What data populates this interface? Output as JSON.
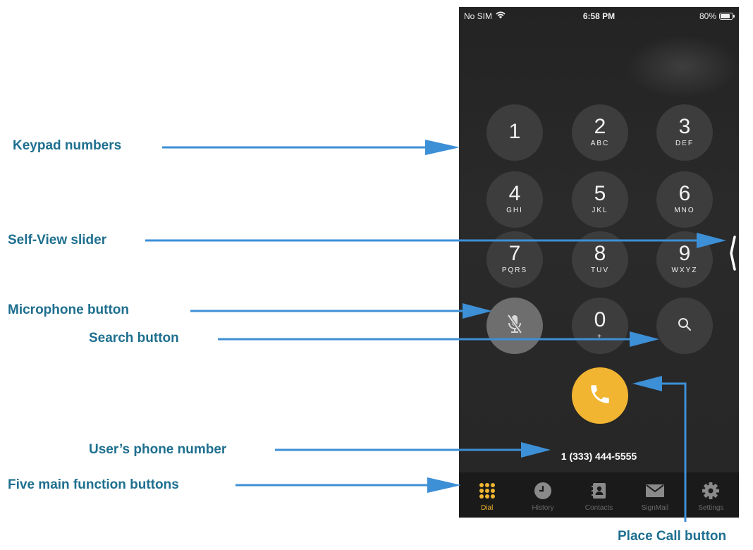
{
  "callouts": {
    "keypad_numbers": "Keypad numbers",
    "self_view_slider": "Self-View slider",
    "microphone_button": "Microphone button",
    "search_button": "Search button",
    "users_phone_number": "User’s phone number",
    "five_main_function_buttons": "Five main function buttons",
    "place_call_button": "Place Call button"
  },
  "status_bar": {
    "carrier": "No SIM",
    "time": "6:58 PM",
    "battery": "80%",
    "battery_level": 0.8
  },
  "keypad": [
    {
      "digit": "1",
      "letters": ""
    },
    {
      "digit": "2",
      "letters": "ABC"
    },
    {
      "digit": "3",
      "letters": "DEF"
    },
    {
      "digit": "4",
      "letters": "GHI"
    },
    {
      "digit": "5",
      "letters": "JKL"
    },
    {
      "digit": "6",
      "letters": "MNO"
    },
    {
      "digit": "7",
      "letters": "PQRS"
    },
    {
      "digit": "8",
      "letters": "TUV"
    },
    {
      "digit": "9",
      "letters": "WXYZ"
    },
    {
      "digit": "0",
      "letters": "+"
    }
  ],
  "user_phone_number": "1 (333) 444-5555",
  "tabs": [
    {
      "label": "Dial",
      "icon": "dial-grid-icon",
      "active": true
    },
    {
      "label": "History",
      "icon": "clock-icon",
      "active": false
    },
    {
      "label": "Contacts",
      "icon": "contacts-book-icon",
      "active": false
    },
    {
      "label": "SignMail",
      "icon": "envelope-icon",
      "active": false
    },
    {
      "label": "Settings",
      "icon": "gear-icon",
      "active": false
    }
  ],
  "colors": {
    "callout_text": "#1e6f8f",
    "arrow": "#3d8fd6",
    "accent": "#f1b531",
    "phone_background": "#262626"
  }
}
